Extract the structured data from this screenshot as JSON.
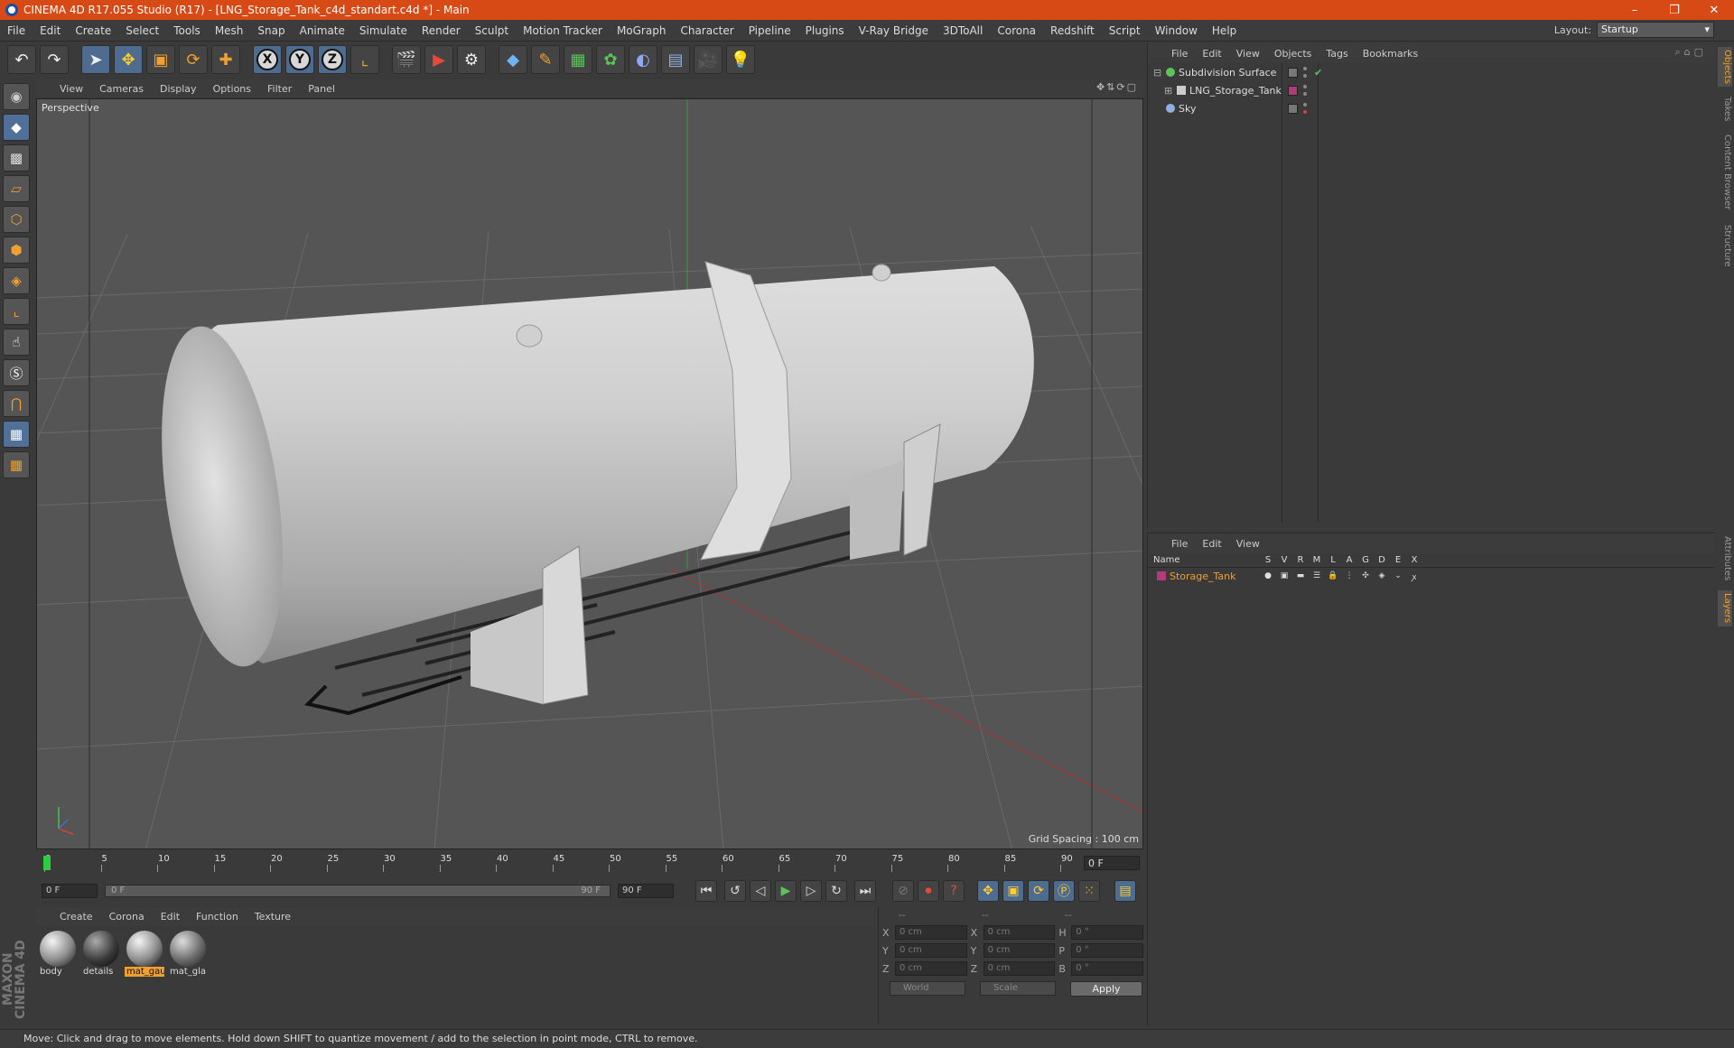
{
  "window": {
    "title": "CINEMA 4D R17.055 Studio (R17) - [LNG_Storage_Tank_c4d_standart.c4d *] - Main",
    "controls": [
      "–",
      "❐",
      "✕"
    ]
  },
  "menu": [
    "File",
    "Edit",
    "Create",
    "Select",
    "Tools",
    "Mesh",
    "Snap",
    "Animate",
    "Simulate",
    "Render",
    "Sculpt",
    "Motion Tracker",
    "MoGraph",
    "Character",
    "Pipeline",
    "Plugins",
    "V-Ray Bridge",
    "3DToAll",
    "Corona",
    "Redshift",
    "Script",
    "Window",
    "Help"
  ],
  "layout": {
    "label": "Layout:",
    "value": "Startup"
  },
  "viewport": {
    "menu": [
      "View",
      "Cameras",
      "Display",
      "Options",
      "Filter",
      "Panel"
    ],
    "name": "Perspective",
    "grid_spacing": "Grid Spacing : 100 cm"
  },
  "timeline": {
    "ticks": [
      "0",
      "5",
      "10",
      "15",
      "20",
      "25",
      "30",
      "35",
      "40",
      "45",
      "50",
      "55",
      "60",
      "65",
      "70",
      "75",
      "80",
      "85",
      "90"
    ],
    "current_frame": "0 F",
    "start_field": "0 F",
    "range_start": "0 F",
    "range_end": "90 F",
    "end_field": "90 F"
  },
  "materials": {
    "menu": [
      "Create",
      "Corona",
      "Edit",
      "Function",
      "Texture"
    ],
    "items": [
      {
        "name": "body",
        "style": "plain",
        "selected": false
      },
      {
        "name": "details",
        "style": "dark",
        "selected": false
      },
      {
        "name": "mat_gau",
        "style": "plain",
        "selected": true
      },
      {
        "name": "mat_gla",
        "style": "glass",
        "selected": false
      }
    ]
  },
  "coords": {
    "headers": [
      "--",
      "--",
      "--"
    ],
    "rows": [
      {
        "a1": "X",
        "v1": "0 cm",
        "a2": "X",
        "v2": "0 cm",
        "a3": "H",
        "v3": "0 °"
      },
      {
        "a1": "Y",
        "v1": "0 cm",
        "a2": "Y",
        "v2": "0 cm",
        "a3": "P",
        "v3": "0 °"
      },
      {
        "a1": "Z",
        "v1": "0 cm",
        "a2": "Z",
        "v2": "0 cm",
        "a3": "B",
        "v3": "0 °"
      }
    ],
    "space": "World",
    "mode": "Scale",
    "apply": "Apply"
  },
  "status": "Move: Click and drag to move elements. Hold down SHIFT to quantize movement / add to the selection in point mode, CTRL to remove.",
  "objects": {
    "menu": [
      "File",
      "Edit",
      "View",
      "Objects",
      "Tags",
      "Bookmarks"
    ],
    "rows": [
      {
        "name": "Subdivision Surface",
        "indent": 0,
        "icon_color": "#5ac45a"
      },
      {
        "name": "LNG_Storage_Tank",
        "indent": 1,
        "icon_color": "#cccccc"
      },
      {
        "name": "Sky",
        "indent": 0,
        "icon_color": "#8fb0e0"
      }
    ]
  },
  "layers": {
    "menu": [
      "File",
      "Edit",
      "View"
    ],
    "header": {
      "name": "Name",
      "cols": [
        "S",
        "V",
        "R",
        "M",
        "L",
        "A",
        "G",
        "D",
        "E",
        "X"
      ]
    },
    "rows": [
      {
        "name": "Storage_Tank",
        "color": "#b13a7a"
      }
    ]
  },
  "sidetabs": [
    "Objects",
    "Takes",
    "Content Browser",
    "Structure",
    "Attributes",
    "Layers"
  ],
  "maxon": "MAXON CINEMA 4D"
}
